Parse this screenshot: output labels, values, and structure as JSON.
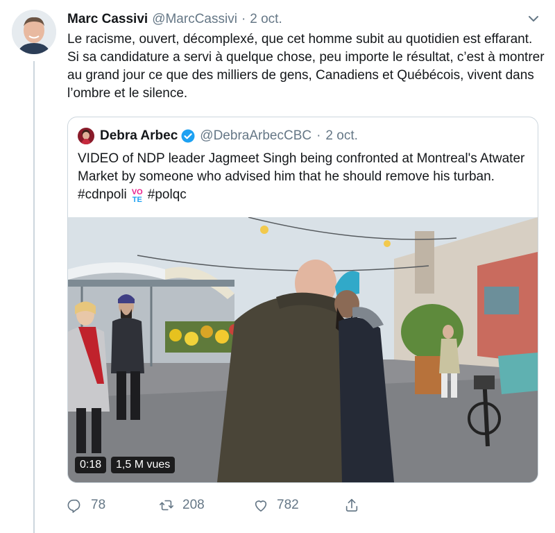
{
  "tweet": {
    "author_name": "Marc Cassivi",
    "handle": "@MarcCassivi",
    "separator": "·",
    "date": "2 oct.",
    "text": "Le racisme, ouvert, décomplexé, que cet homme subit au quotidien est effarant. Si sa candidature a servi à quelque chose, peu importe le résultat, c’est à montrer au grand jour ce que des milliers de gens, Canadiens et Québécois, vivent dans l’ombre et le silence."
  },
  "quoted": {
    "author_name": "Debra Arbec",
    "handle": "@DebraArbecCBC",
    "separator": "·",
    "date": "2 oct.",
    "text_main": "VIDEO of NDP leader Jagmeet Singh being confronted at Montreal's Atwater Market by someone who advised him that he should remove his turban. ",
    "hashtag1": "#cdnpoli",
    "vote_top": "VO",
    "vote_bottom": "TE",
    "hashtag2": "#polqc",
    "video_time": "0:18",
    "video_views": "1,5 M vues"
  },
  "actions": {
    "replies": "78",
    "retweets": "208",
    "likes": "782"
  },
  "colors": {
    "text": "#14171a",
    "muted": "#657786",
    "border": "#ccd6dd",
    "verified": "#1da1f2"
  },
  "icons": {
    "caret": "chevron-down-icon",
    "verified": "verified-badge-icon",
    "reply": "reply-icon",
    "retweet": "retweet-icon",
    "like": "heart-icon",
    "share": "share-icon"
  }
}
